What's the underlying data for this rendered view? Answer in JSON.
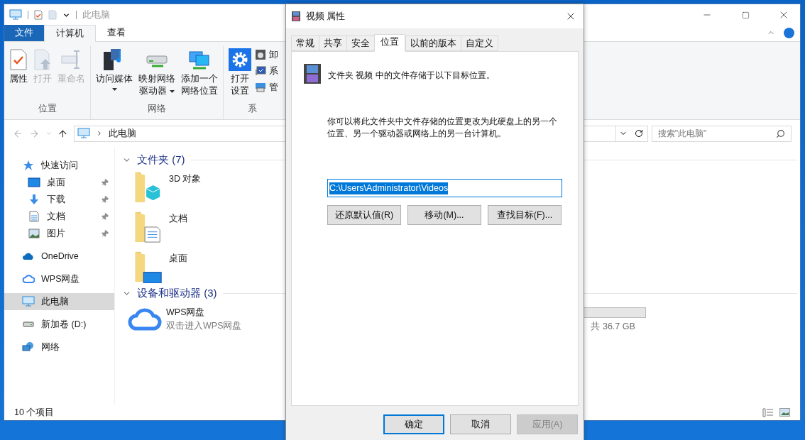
{
  "explorer": {
    "title": "此电脑",
    "ribbon_tabs": [
      {
        "label": "文件",
        "kind": "file",
        "selected": false
      },
      {
        "label": "计算机",
        "kind": "tab",
        "selected": true
      },
      {
        "label": "查看",
        "kind": "tab",
        "selected": false
      }
    ],
    "ribbon_groups": [
      {
        "label": "位置",
        "commands": [
          {
            "kind": "large",
            "lines": [
              "属性"
            ],
            "disabled": false
          },
          {
            "kind": "large",
            "lines": [
              "打开"
            ],
            "disabled": true
          },
          {
            "kind": "large",
            "lines": [
              "重命名"
            ],
            "disabled": true
          }
        ]
      },
      {
        "label": "网络",
        "commands": [
          {
            "kind": "large",
            "lines": [
              "访问媒体"
            ],
            "dropdown": true
          },
          {
            "kind": "large",
            "lines": [
              "映射网络",
              "驱动器"
            ],
            "dropdown": true
          },
          {
            "kind": "large",
            "lines": [
              "添加一个",
              "网络位置"
            ],
            "dropdown": false
          }
        ]
      },
      {
        "label": "系",
        "commands": [
          {
            "kind": "large",
            "lines": [
              "打开",
              "设置"
            ]
          },
          {
            "kind": "small",
            "lines": [
              "卸"
            ]
          },
          {
            "kind": "small",
            "lines": [
              "系"
            ]
          },
          {
            "kind": "small",
            "lines": [
              "管"
            ]
          }
        ]
      }
    ],
    "address": {
      "path": "此电脑"
    },
    "search": {
      "placeholder": "搜索\"此电脑\""
    },
    "sidebar": [
      {
        "label": "快速访问",
        "selected": false,
        "children": [
          {
            "label": "桌面",
            "pinned": true,
            "selected": false
          },
          {
            "label": "下载",
            "pinned": true,
            "selected": false
          },
          {
            "label": "文档",
            "pinned": true,
            "selected": false
          },
          {
            "label": "图片",
            "pinned": true,
            "selected": false
          }
        ]
      },
      {
        "label": "OneDrive",
        "selected": false
      },
      {
        "label": "WPS网盘",
        "selected": false
      },
      {
        "label": "此电脑",
        "selected": true
      },
      {
        "label": "新加卷 (D:)",
        "selected": false
      },
      {
        "label": "网络",
        "selected": false
      }
    ],
    "sections": [
      {
        "title": "文件夹 (7)",
        "items": [
          {
            "name": "3D 对象"
          },
          {
            "name": "文档"
          },
          {
            "name": "桌面"
          }
        ]
      },
      {
        "title": "设备和驱动器 (3)",
        "items": [
          {
            "name": "WPS网盘",
            "detail": "双击进入WPS网盘"
          }
        ],
        "drive_total": "共 36.7 GB"
      }
    ],
    "status": "10 个项目"
  },
  "dialog": {
    "title": "视频 属性",
    "tabs": [
      {
        "label": "常规",
        "selected": false
      },
      {
        "label": "共享",
        "selected": false
      },
      {
        "label": "安全",
        "selected": false
      },
      {
        "label": "位置",
        "selected": true
      },
      {
        "label": "以前的版本",
        "selected": false
      },
      {
        "label": "自定义",
        "selected": false
      }
    ],
    "heading": "文件夹 视频 中的文件存储于以下目标位置。",
    "description": "你可以将此文件夹中文件存储的位置更改为此硬盘上的另一个位置、另一个驱动器或网络上的另一台计算机。",
    "path": "C:\\Users\\Administrator\\Videos",
    "actions": [
      "还原默认值(R)",
      "移动(M)...",
      "查找目标(F)..."
    ],
    "buttons": [
      {
        "label": "确定",
        "kind": "default",
        "disabled": false
      },
      {
        "label": "取消",
        "kind": "normal",
        "disabled": false
      },
      {
        "label": "应用(A)",
        "kind": "normal",
        "disabled": true
      }
    ]
  }
}
